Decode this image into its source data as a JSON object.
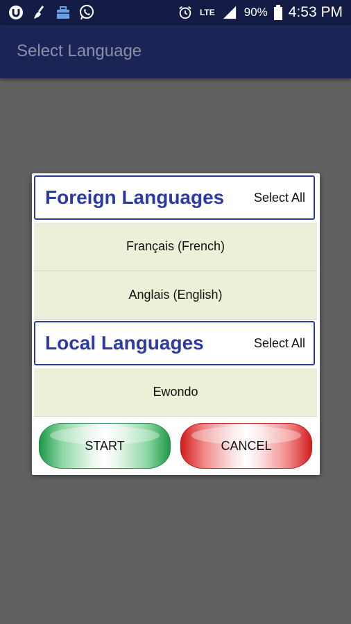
{
  "status_bar": {
    "left_icons": [
      "app-u-icon",
      "broom-icon",
      "briefcase-icon",
      "whatsapp-icon"
    ],
    "right_icons": [
      "alarm-icon",
      "lte-icon",
      "signal-icon",
      "battery-icon"
    ],
    "network": "LTE",
    "battery": "90%",
    "time": "4:53 PM"
  },
  "appbar": {
    "title": "Select Language"
  },
  "dialog": {
    "sections": [
      {
        "title": "Foreign Languages",
        "select_all": "Select All",
        "items": [
          "Français (French)",
          "Anglais (English)"
        ]
      },
      {
        "title": "Local Languages",
        "select_all": "Select All",
        "items": [
          "Ewondo"
        ]
      }
    ],
    "buttons": {
      "start": "START",
      "cancel": "CANCEL"
    }
  },
  "colors": {
    "app_bar": "#1c2456",
    "section_title": "#2b3aa6",
    "row_background": "#edf0d8",
    "start_button": "#1f9a4a",
    "cancel_button": "#d21e1e"
  }
}
